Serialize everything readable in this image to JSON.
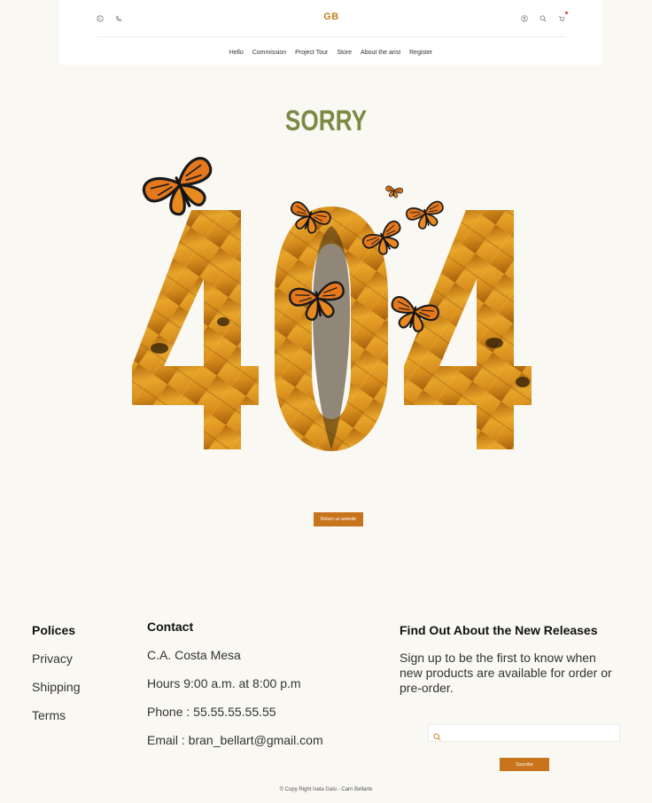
{
  "header": {
    "logo": "GB",
    "icons": [
      "whatsapp-icon",
      "phone-icon",
      "user-icon",
      "search-icon",
      "cart-icon"
    ]
  },
  "nav": {
    "items": [
      {
        "label": "Hello"
      },
      {
        "label": "Commission"
      },
      {
        "label": "Project Tour"
      },
      {
        "label": "Store"
      },
      {
        "label": "About the arist"
      },
      {
        "label": "Register"
      }
    ]
  },
  "error": {
    "title": "SORRY",
    "code": "404",
    "return_label": "Return us website"
  },
  "footer": {
    "policies": {
      "heading": "Polices",
      "links": [
        "Privacy",
        "Shipping",
        "Terms"
      ]
    },
    "contact": {
      "heading": "Contact",
      "address": "C.A. Costa Mesa",
      "hours": "Hours 9:00 a.m. at 8:00 p.m",
      "phone": "Phone : 55.55.55.55.55",
      "email": "Email : bran_bellart@gmail.com"
    },
    "newsletter": {
      "heading": "Find Out About the New Releases",
      "text": "Sign up to be the first to know when new products are available for order or pre-order.",
      "search_value": "",
      "subscribe_label": "Suscribe"
    },
    "copyright": "© Copy Right Isela Galo - Carn Bellarte"
  },
  "colors": {
    "accent": "#c8741c",
    "title": "#7d8a45",
    "background": "#f9f8f3"
  }
}
